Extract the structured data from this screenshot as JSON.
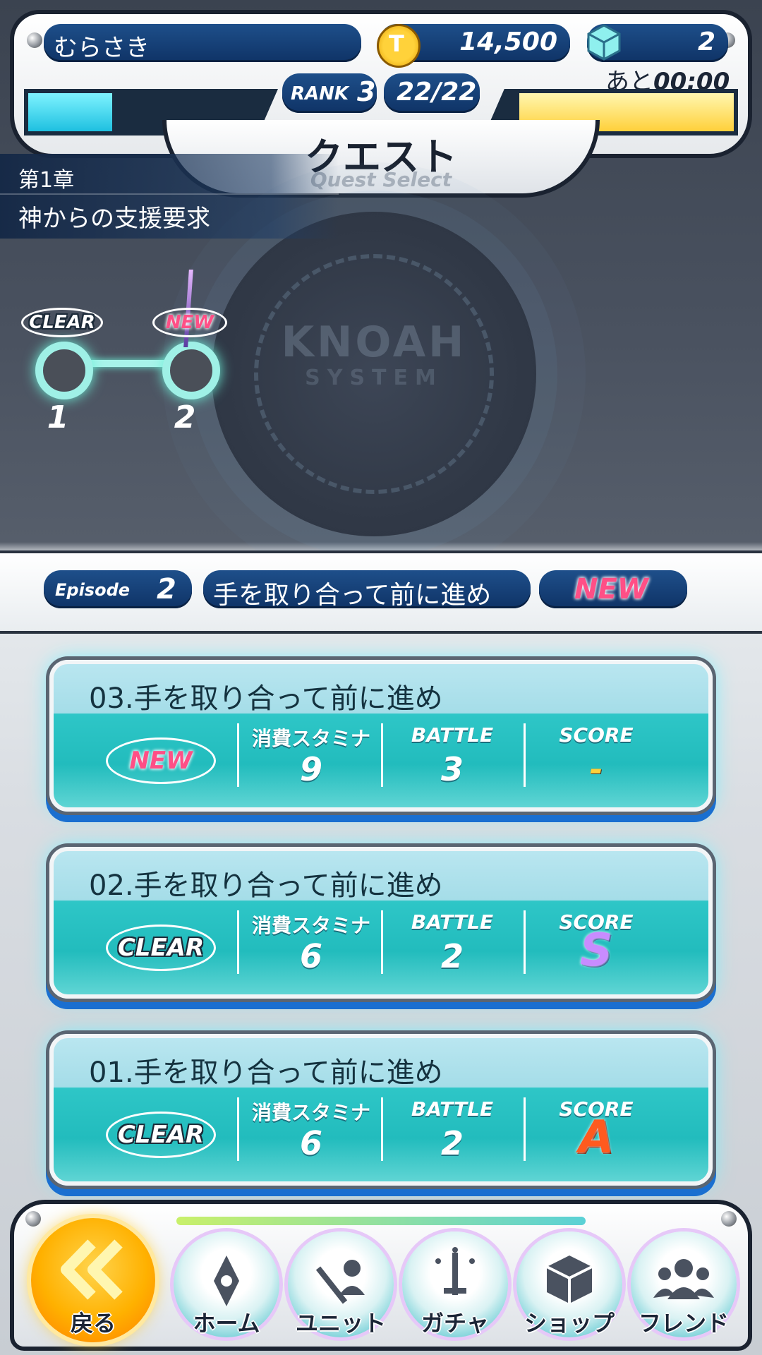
{
  "hud": {
    "player_name": "むらさき",
    "coins": "14,500",
    "gems": "2",
    "stamina_timer_prefix": "あと",
    "stamina_timer": "00:00",
    "rank_label": "RANK",
    "rank_value": "3",
    "stamina": "22/22",
    "stamina_fill": 0.35,
    "exp_fill": 0.95
  },
  "header": {
    "title": "クエスト",
    "subtitle": "Quest Select"
  },
  "chapter": {
    "label": "第1章",
    "name": "神からの支援要求"
  },
  "map": {
    "background_text_1": "KNOAH",
    "background_text_2": "SYSTEM",
    "nodes": [
      {
        "number": "1",
        "badge": "CLEAR"
      },
      {
        "number": "2",
        "badge": "NEW"
      }
    ]
  },
  "episode": {
    "label": "Episode",
    "number": "2",
    "title": "手を取り合って前に進め",
    "badge": "NEW"
  },
  "quests": [
    {
      "title": "03.手を取り合って前に進め",
      "status": "NEW",
      "stamina_label": "消費スタミナ",
      "stamina": "9",
      "battle_label": "BATTLE",
      "battle": "3",
      "score_label": "SCORE",
      "score": "-"
    },
    {
      "title": "02.手を取り合って前に進め",
      "status": "CLEAR",
      "stamina_label": "消費スタミナ",
      "stamina": "6",
      "battle_label": "BATTLE",
      "battle": "2",
      "score_label": "SCORE",
      "score": "S"
    },
    {
      "title": "01.手を取り合って前に進め",
      "status": "CLEAR",
      "stamina_label": "消費スタミナ",
      "stamina": "6",
      "battle_label": "BATTLE",
      "battle": "2",
      "score_label": "SCORE",
      "score": "A"
    }
  ],
  "nav": [
    {
      "label": "戻る",
      "icon": "back-chevrons-icon"
    },
    {
      "label": "ホーム",
      "icon": "home-icon"
    },
    {
      "label": "ユニット",
      "icon": "unit-icon"
    },
    {
      "label": "ガチャ",
      "icon": "gacha-icon"
    },
    {
      "label": "ショップ",
      "icon": "shop-icon"
    },
    {
      "label": "フレンド",
      "icon": "friend-icon"
    }
  ],
  "colors": {
    "accent_cyan": "#2ec6c7",
    "navy": "#0f3366",
    "new_pink": "#ff4f86",
    "score_s": "#c88cff",
    "score_a": "#ff5a1f"
  }
}
